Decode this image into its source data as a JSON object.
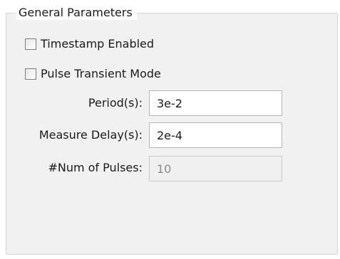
{
  "group": {
    "title": "General Parameters"
  },
  "checkboxes": [
    {
      "label": "Timestamp Enabled",
      "checked": false
    },
    {
      "label": "Pulse Transient Mode",
      "checked": false
    }
  ],
  "fields": [
    {
      "label": "Period(s):",
      "value": "3e-2",
      "enabled": true
    },
    {
      "label": "Measure Delay(s):",
      "value": "2e-4",
      "enabled": true
    },
    {
      "label": "#Num of Pulses:",
      "value": "10",
      "enabled": false
    }
  ]
}
